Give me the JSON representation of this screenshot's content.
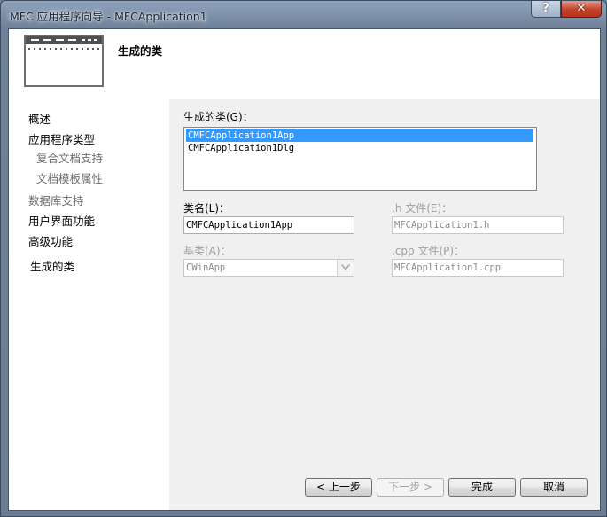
{
  "window": {
    "title": "MFC 应用程序向导 - MFCApplication1",
    "help_label": "?",
    "close_label": "✕"
  },
  "header": {
    "title": "生成的类",
    "icon": "wizard-window-icon"
  },
  "nav": {
    "items": [
      {
        "label": "概述",
        "state": "normal"
      },
      {
        "label": "应用程序类型",
        "state": "normal"
      },
      {
        "label": "复合文档支持",
        "state": "disabled"
      },
      {
        "label": "文档模板属性",
        "state": "disabled"
      },
      {
        "label": "数据库支持",
        "state": "disabled"
      },
      {
        "label": "用户界面功能",
        "state": "normal"
      },
      {
        "label": "高级功能",
        "state": "normal"
      },
      {
        "label": "生成的类",
        "state": "selected"
      }
    ]
  },
  "classes": {
    "label": "生成的类(G)：",
    "items": [
      "CMFCApplication1App",
      "CMFCApplication1Dlg"
    ],
    "selected_index": 0
  },
  "fields": {
    "class_name": {
      "label": "类名(L)：",
      "value": "CMFCApplication1App"
    },
    "h_file": {
      "label": ".h 文件(E)：",
      "value": "MFCApplication1.h"
    },
    "base_class": {
      "label": "基类(A)：",
      "value": "CWinApp"
    },
    "cpp_file": {
      "label": ".cpp 文件(P)：",
      "value": "MFCApplication1.cpp"
    }
  },
  "buttons": {
    "prev": "< 上一步",
    "next": "下一步 >",
    "finish": "完成",
    "cancel": "取消"
  },
  "colors": {
    "selection": "#3399ff",
    "disabled_text": "#a0a0a0"
  }
}
